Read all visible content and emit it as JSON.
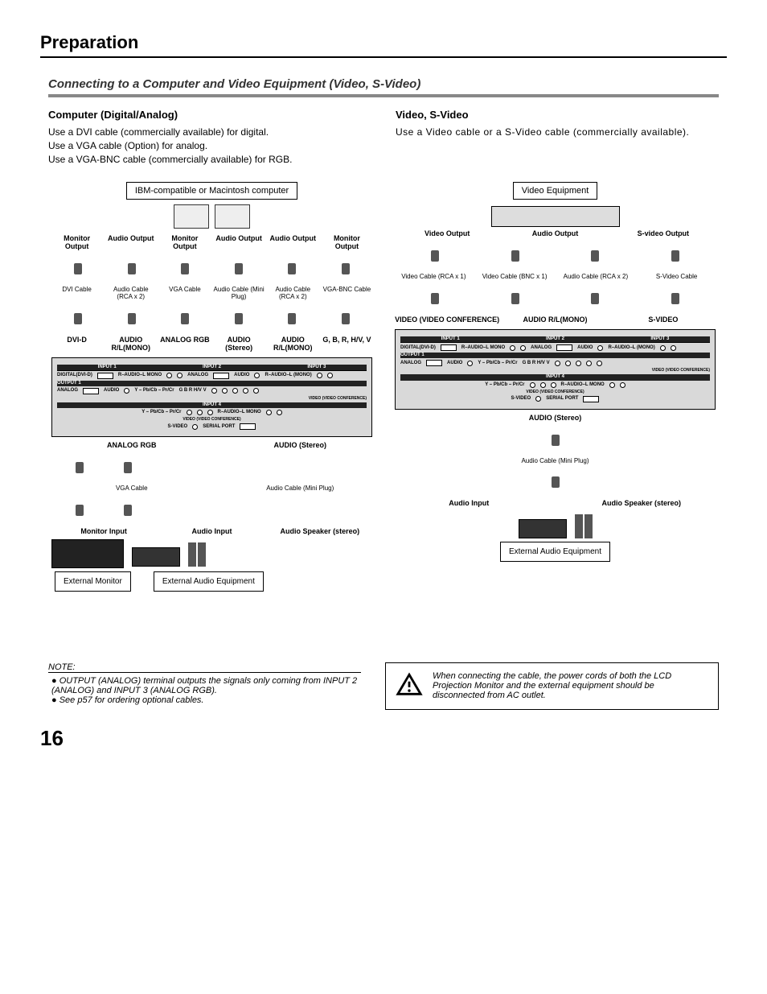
{
  "page": {
    "title": "Preparation",
    "number": "16"
  },
  "subsection": {
    "title": "Connecting to a Computer and Video Equipment (Video, S-Video)"
  },
  "left_col": {
    "heading": "Computer (Digital/Analog)",
    "body_line1": "Use a DVI cable (commercially available) for digital.",
    "body_line2": "Use a VGA cable (Option) for analog.",
    "body_line3": "Use a VGA-BNC cable (commercially available) for RGB."
  },
  "right_col": {
    "heading": "Video, S-Video",
    "body": "Use a Video cable or a S-Video cable (commercially available)."
  },
  "diagram_left": {
    "source_box": "IBM-compatible or Macintosh computer",
    "top_labels": [
      "Monitor Output",
      "Audio Output",
      "Monitor Output",
      "Audio Output",
      "Audio Output",
      "Monitor Output"
    ],
    "cable_labels": [
      "DVI Cable",
      "Audio Cable (RCA x 2)",
      "VGA Cable",
      "Audio Cable (Mini Plug)",
      "Audio Cable (RCA x 2)",
      "VGA-BNC Cable"
    ],
    "input_labels": [
      "DVI-D",
      "AUDIO R/L(MONO)",
      "ANALOG RGB",
      "AUDIO (Stereo)",
      "AUDIO R/L(MONO)",
      "G, B, R, H/V, V"
    ],
    "panel": {
      "row_inputs": [
        "INPUT 1",
        "INPUT 2",
        "INPUT 3"
      ],
      "r1": [
        "DIGITAL(DVI-D)",
        "R–AUDIO–L MONO",
        "ANALOG",
        "AUDIO",
        "R–AUDIO–L (MONO)"
      ],
      "output_row": "OUTPUT 1",
      "r2": [
        "ANALOG",
        "AUDIO",
        "Y – Pb/Cb – Pr/Cr",
        "G  B  R  H/V  V"
      ],
      "vc": "VIDEO (VIDEO CONFERENCE)",
      "input4": "INPUT 4",
      "r3": [
        "Y – Pb/Cb – Pr/Cr",
        "R–AUDIO–L MONO"
      ],
      "vc2": "VIDEO (VIDEO CONFERENCE)",
      "r4": [
        "S-VIDEO",
        "SERIAL PORT"
      ]
    },
    "out_labels": [
      "ANALOG RGB",
      "AUDIO (Stereo)"
    ],
    "out_cables": [
      "VGA Cable",
      "Audio Cable (Mini Plug)"
    ],
    "dest_labels": [
      "Monitor Input",
      "Audio Input",
      "Audio Speaker (stereo)"
    ],
    "dest_boxes": [
      "External Monitor",
      "External Audio Equipment"
    ]
  },
  "diagram_right": {
    "source_box": "Video Equipment",
    "top_labels": [
      "Video Output",
      "Audio Output",
      "S-video Output"
    ],
    "cable_labels": [
      "Video Cable (RCA x 1)",
      "Video Cable (BNC x 1)",
      "Audio Cable (RCA x 2)",
      "S-Video Cable"
    ],
    "input_labels": [
      "VIDEO (VIDEO CONFERENCE)",
      "AUDIO R/L(MONO)",
      "S-VIDEO"
    ],
    "panel": {
      "row_inputs": [
        "INPUT 1",
        "INPUT 2",
        "INPUT 3"
      ],
      "r1": [
        "DIGITAL(DVI-D)",
        "R–AUDIO–L MONO",
        "ANALOG",
        "AUDIO",
        "R–AUDIO–L (MONO)"
      ],
      "output_row": "OUTPUT 1",
      "r2": [
        "ANALOG",
        "AUDIO",
        "Y – Pb/Cb – Pr/Cr",
        "G  B  R  H/V  V"
      ],
      "vc": "VIDEO (VIDEO CONFERENCE)",
      "input4": "INPUT 4",
      "r3": [
        "Y – Pb/Cb – Pr/Cr",
        "R–AUDIO–L MONO"
      ],
      "vc2": "VIDEO (VIDEO CONFERENCE)",
      "r4": [
        "S-VIDEO",
        "SERIAL PORT"
      ]
    },
    "out_labels": [
      "AUDIO (Stereo)"
    ],
    "out_cables": [
      "Audio Cable (Mini Plug)"
    ],
    "dest_labels": [
      "Audio Input",
      "Audio Speaker (stereo)"
    ],
    "dest_boxes": [
      "External Audio Equipment"
    ]
  },
  "notes": {
    "heading": "NOTE:",
    "items": [
      "OUTPUT (ANALOG) terminal outputs the signals only coming from INPUT 2 (ANALOG) and INPUT 3 (ANALOG RGB).",
      "See p57 for ordering optional cables."
    ]
  },
  "warning": {
    "text": "When connecting the cable, the power cords of both the LCD Projection Monitor and the external equipment should be disconnected from AC outlet."
  }
}
